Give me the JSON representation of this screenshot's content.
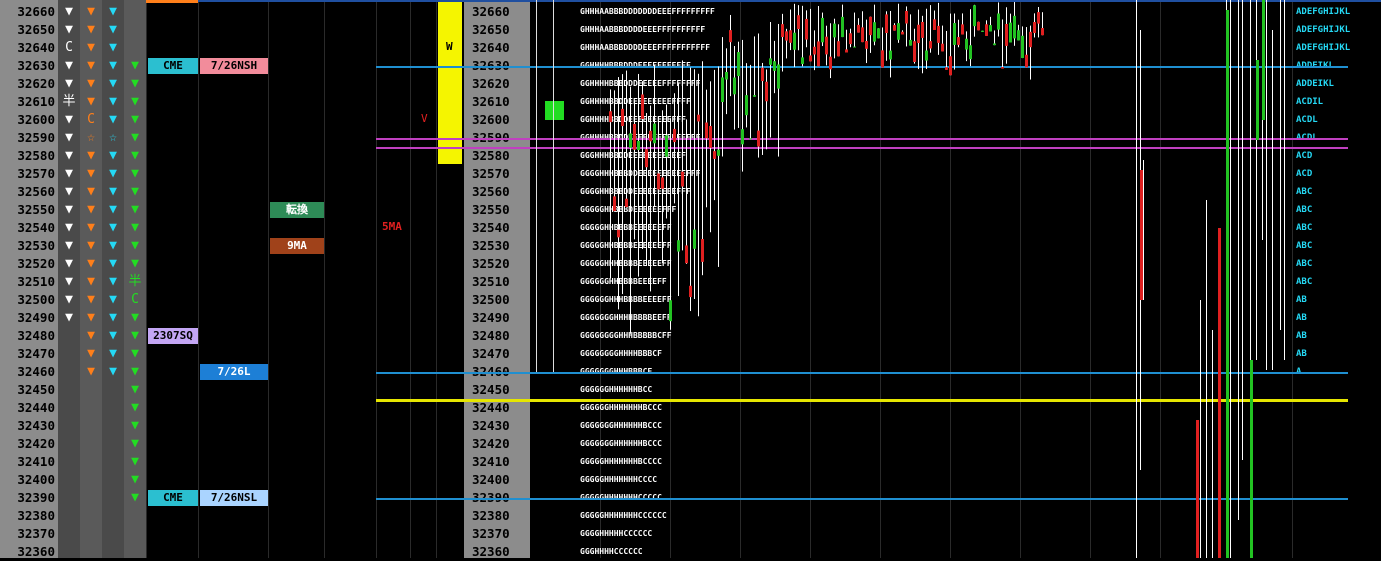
{
  "chart_data": {
    "type": "market-profile",
    "prices": [
      32660,
      32650,
      32640,
      32630,
      32620,
      32610,
      32600,
      32590,
      32580,
      32570,
      32560,
      32550,
      32540,
      32530,
      32520,
      32510,
      32500,
      32490,
      32480,
      32470,
      32460,
      32450,
      32440,
      32430,
      32420,
      32410,
      32400,
      32390,
      32380,
      32370,
      32360
    ],
    "col1": [
      "w",
      "w",
      "C",
      "w",
      "w",
      "半",
      "w",
      "w",
      "w",
      "w",
      "w",
      "w",
      "w",
      "w",
      "w",
      "w",
      "w",
      "w",
      "",
      "",
      "",
      "",
      "",
      "",
      "",
      "",
      "",
      "",
      "",
      "",
      ""
    ],
    "col2": [
      "o",
      "o",
      "o",
      "o",
      "o",
      "o",
      "C",
      "☆",
      "o",
      "o",
      "o",
      "o",
      "o",
      "o",
      "o",
      "o",
      "o",
      "o",
      "o",
      "o",
      "o",
      "",
      "",
      "",
      "",
      "",
      "",
      "",
      "",
      "",
      ""
    ],
    "col3": [
      "c",
      "c",
      "c",
      "c",
      "c",
      "c",
      "c",
      "☆",
      "c",
      "c",
      "c",
      "c",
      "c",
      "c",
      "c",
      "c",
      "c",
      "c",
      "c",
      "c",
      "c",
      "",
      "",
      "",
      "",
      "",
      "",
      "",
      "",
      "",
      ""
    ],
    "col4": [
      "",
      "",
      "",
      "g",
      "g",
      "g",
      "g",
      "g",
      "g",
      "g",
      "g",
      "g",
      "g",
      "g",
      "g",
      "半",
      "C",
      "g",
      "g",
      "g",
      "g",
      "g",
      "g",
      "g",
      "g",
      "g",
      "g",
      "g",
      "",
      "",
      ""
    ],
    "profile_letters": [
      "GHHHAABBBDDDDDDDEEEFFFFFFFFF",
      "GHHHAABBBDDDDEEEFFFFFFFFFF",
      "GHHHAABBBDDDDEEEFFFFFFFFFFF",
      "GGHHHHBBBDDDEEEFFFFFFFF",
      "GGHHHHBBBDDDEEEEEFFFFFFFF",
      "GGHHHHBBDDEEEEEEEEEFFFF",
      "GGHHHHBBDDEEEEEEEEEFFF",
      "GGHHHHBBDDEEEEEEEEEEEEFFF",
      "GGGHHHBBDDEEEEEEEEEEEF",
      "GGGGHHHBBBDDEEEEEEEEEEFFF",
      "GGGGHHBBBDDEEEEEEEEEFFF",
      "GGGGGHHBBBDEEEEEEFFF",
      "GGGGGHHBBBBEEEEEEFF",
      "GGGGGHHBBBBEEEEEEFF",
      "GGGGGHHHBBBBEEEEEFF",
      "GGGGGGHHBBBBEEEEFF",
      "GGGGGGHHHBBBBEEEEFF",
      "GGGGGGGHHHHBBBBEEFF",
      "GGGGGGGGHHHBBBBBCFF",
      "GGGGGGGGHHHHBBBCF",
      "GGGGGGGHHHBBBCF",
      "GGGGGGHHHHHHBCC",
      "GGGGGGHHHHHHHBCCC",
      "GGGGGGGHHHHHHBCCC",
      "GGGGGGGHHHHHHBCCC",
      "GGGGGHHHHHHHBCCCC",
      "GGGGGHHHHHHHCCCC",
      "GGGGGHHHHHHHCCCCC",
      "GGGGGHHHHHHHCCCCCC",
      "GGGGHHHHHCCCCCC",
      "GGGHHHHCCCCCC"
    ],
    "right_letters": [
      "ADEFGHIJKL",
      "ADEFGHIJKL",
      "ADEFGHIJKL",
      "ADDEIKL",
      "ADDEIKL",
      "ACDIL",
      "ACDL",
      "ACDL",
      "ACD",
      "ACD",
      "ABC",
      "ABC",
      "ABC",
      "ABC",
      "ABC",
      "ABC",
      "AB",
      "AB",
      "AB",
      "AB",
      "A",
      "",
      "",
      "",
      "",
      "",
      "",
      "",
      "",
      "",
      ""
    ],
    "level_tags": [
      {
        "price": 32630,
        "col": "a",
        "text": "CME",
        "bg": "#2bbfd0",
        "fg": "#000"
      },
      {
        "price": 32630,
        "col": "b",
        "text": "7/26NSH",
        "bg": "#f28c9b",
        "fg": "#000"
      },
      {
        "price": 32480,
        "col": "a",
        "text": "2307SQ",
        "bg": "#c3a6f4",
        "fg": "#000"
      },
      {
        "price": 32460,
        "col": "b",
        "text": "7/26L",
        "bg": "#1d7fd6",
        "fg": "#fff"
      },
      {
        "price": 32390,
        "col": "a",
        "text": "CME",
        "bg": "#2bbfd0",
        "fg": "#000"
      },
      {
        "price": 32390,
        "col": "b",
        "text": "7/26NSL",
        "bg": "#aad4ff",
        "fg": "#000"
      },
      {
        "price": 32550,
        "col": "c",
        "text": "転換",
        "bg": "#2e8b57",
        "fg": "#fff"
      },
      {
        "price": 32530,
        "col": "c",
        "text": "9MA",
        "bg": "#a0421a",
        "fg": "#fff"
      }
    ],
    "label_5ma": "5MA",
    "label_v": "V",
    "label_w": "W",
    "horizontal_lines": [
      {
        "price": 32630,
        "color": "#1f8fd0"
      },
      {
        "price": 32590,
        "color": "#c040c0"
      },
      {
        "price": 32585,
        "color": "#c040c0"
      },
      {
        "price": 32460,
        "color": "#1f8fd0"
      },
      {
        "price": 32445,
        "color": "#e6e600"
      },
      {
        "price": 32390,
        "color": "#1f8fd0"
      }
    ],
    "colors": {
      "up": "#22c322",
      "down": "#e02020",
      "wick": "#ffffff",
      "cyan": "#25d9f5",
      "orange": "#ff7f1a",
      "green": "#22dd22"
    }
  }
}
